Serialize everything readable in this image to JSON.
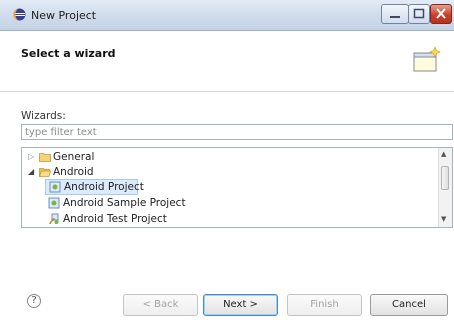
{
  "window": {
    "title": "New Project"
  },
  "header": {
    "title": "Select a wizard"
  },
  "wizards": {
    "label": "Wizards:",
    "filter_placeholder": "type filter text",
    "tree": [
      {
        "label": "General",
        "expanded": false,
        "icon": "folder-icon"
      },
      {
        "label": "Android",
        "expanded": true,
        "icon": "folder-icon"
      },
      {
        "label": "Android Project",
        "selected": true,
        "icon": "android-project-icon"
      },
      {
        "label": "Android Sample Project",
        "icon": "android-project-icon"
      },
      {
        "label": "Android Test Project",
        "icon": "android-test-icon"
      }
    ]
  },
  "buttons": {
    "help": "?",
    "back": "< Back",
    "next": "Next >",
    "finish": "Finish",
    "cancel": "Cancel"
  }
}
